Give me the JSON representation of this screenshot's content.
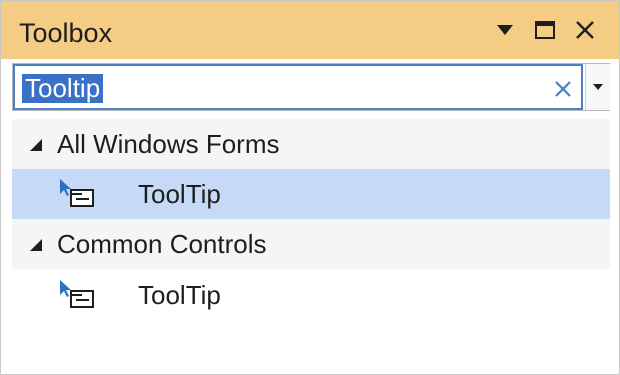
{
  "window": {
    "title": "Toolbox",
    "accent_color": "#f5cc84",
    "buttons": [
      {
        "name": "dropdown",
        "icon": "triangle-down-icon"
      },
      {
        "name": "maximize",
        "icon": "maximize-icon"
      },
      {
        "name": "close",
        "icon": "close-icon"
      }
    ]
  },
  "search": {
    "value": "Tooltip",
    "clear_icon": "clear-icon",
    "selection_color": "#3a70c6"
  },
  "groups": [
    {
      "label": "All Windows Forms",
      "expanded": true,
      "items": [
        {
          "label": "ToolTip",
          "icon": "tooltip-icon",
          "selected": true
        }
      ]
    },
    {
      "label": "Common Controls",
      "expanded": true,
      "items": [
        {
          "label": "ToolTip",
          "icon": "tooltip-icon",
          "selected": false
        }
      ]
    }
  ]
}
